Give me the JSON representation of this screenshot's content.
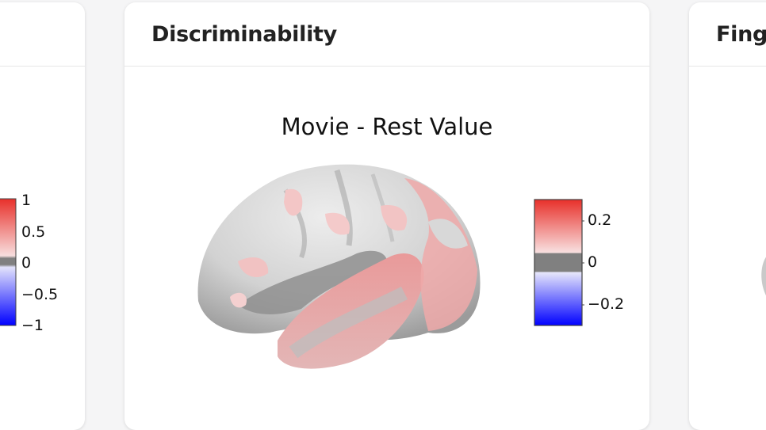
{
  "cards": {
    "left": {
      "title": ""
    },
    "main": {
      "title": "Discriminability"
    },
    "right": {
      "title": "Finge"
    }
  },
  "plot": {
    "title": "Movie - Rest Value"
  },
  "colorbar_main": {
    "ticks": [
      "0.2",
      "0",
      "−0.2"
    ],
    "colors": {
      "positive": "#e8302a",
      "zero": "#808080",
      "negative": "#0000ff"
    }
  },
  "colorbar_left": {
    "ticks": [
      "1",
      "0.5",
      "0",
      "−0.5",
      "−1"
    ]
  }
}
